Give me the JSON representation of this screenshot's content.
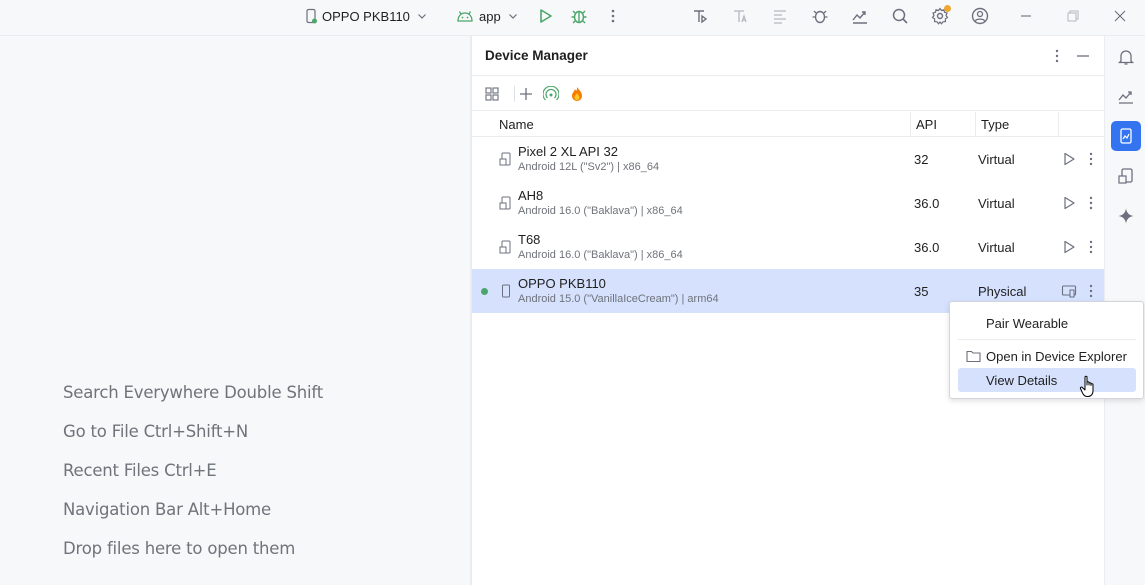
{
  "topbar": {
    "device_selector": "OPPO PKB110",
    "run_config": "app"
  },
  "welcome": {
    "hints": [
      "Search Everywhere Double Shift",
      "Go to File Ctrl+Shift+N",
      "Recent Files Ctrl+E",
      "Navigation Bar Alt+Home",
      "Drop files here to open them"
    ]
  },
  "device_manager": {
    "title": "Device Manager",
    "columns": {
      "name": "Name",
      "api": "API",
      "type": "Type"
    },
    "devices": [
      {
        "name": "Pixel 2 XL API 32",
        "detail": "Android 12L (\"Sv2\") | x86_64",
        "api": "32",
        "type": "Virtual",
        "online": false,
        "selected": false
      },
      {
        "name": "AH8",
        "detail": "Android 16.0 (\"Baklava\") | x86_64",
        "api": "36.0",
        "type": "Virtual",
        "online": false,
        "selected": false
      },
      {
        "name": "T68",
        "detail": "Android 16.0 (\"Baklava\") | x86_64",
        "api": "36.0",
        "type": "Virtual",
        "online": false,
        "selected": false
      },
      {
        "name": "OPPO PKB110",
        "detail": "Android 15.0 (\"VanillaIceCream\") | arm64",
        "api": "35",
        "type": "Physical",
        "online": true,
        "selected": true
      }
    ]
  },
  "context_menu": {
    "items": [
      {
        "label": "Pair Wearable",
        "icon": ""
      },
      {
        "label": "Open in Device Explorer",
        "icon": "folder-icon"
      },
      {
        "label": "View Details",
        "icon": ""
      }
    ],
    "highlighted_index": 2
  },
  "colors": {
    "accent": "#3574f0",
    "selection": "#d5e1fd",
    "run_green": "#4ca66b",
    "notification_dot": "#f0a732"
  }
}
